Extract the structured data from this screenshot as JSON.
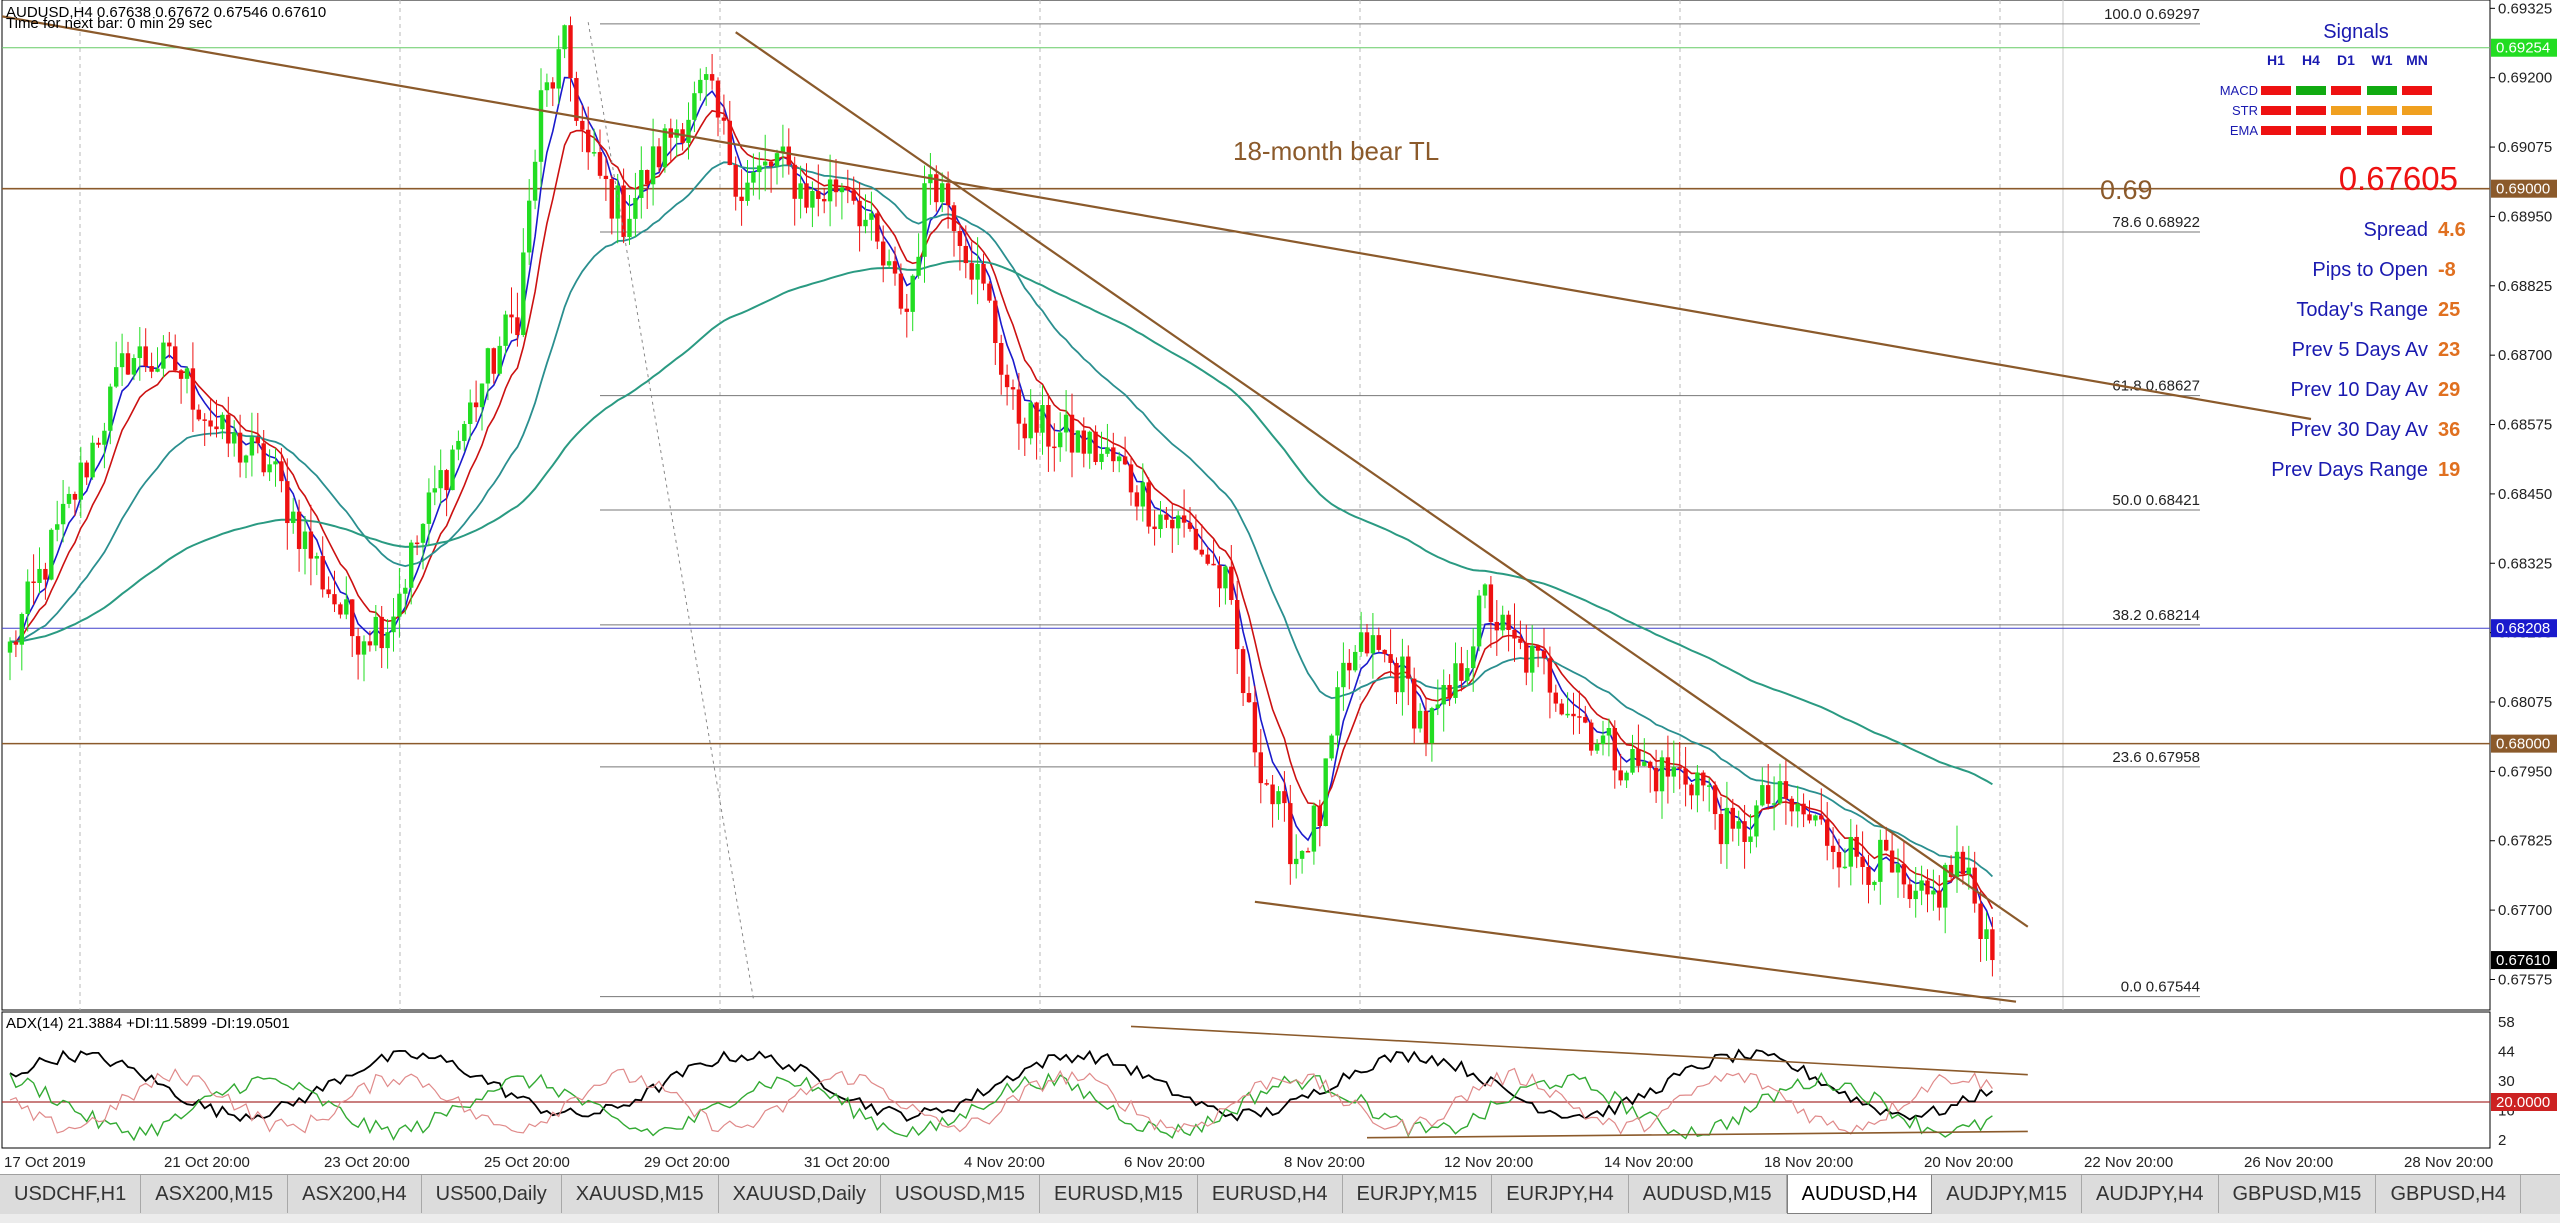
{
  "header": {
    "symbol_line": "AUDUSD,H4  0.67638 0.67672 0.67546 0.67610",
    "timer_line": "Time for next bar: 0 min 29 sec"
  },
  "colors": {
    "bull": "#22dd22",
    "bear": "#ee1111",
    "ema_fast": "#1a1acc",
    "ema_mid": "#cc1111",
    "ema_slow": "#2a8f8f",
    "ema_long": "#2a9a82",
    "trendline": "#8b5a2b",
    "hline_green": "#66cc66",
    "hline_blue": "#4040cc",
    "hline_brown": "#8b5a2b",
    "adx_main": "#000000",
    "adx_plus": "#33aa33",
    "adx_minus": "#e08a8a"
  },
  "annotations": {
    "trendline_label": "18-month bear TL",
    "level_label": "0.69"
  },
  "panel": {
    "signals_title": "Signals",
    "timeframes": [
      "H1",
      "H4",
      "D1",
      "W1",
      "MN"
    ],
    "rows": [
      {
        "name": "MACD",
        "colors": [
          "#ee1111",
          "#11aa11",
          "#ee1111",
          "#11aa11",
          "#ee1111"
        ]
      },
      {
        "name": "STR",
        "colors": [
          "#ee1111",
          "#ee1111",
          "#f0a020",
          "#f0a020",
          "#f0a020"
        ]
      },
      {
        "name": "EMA",
        "colors": [
          "#ee1111",
          "#ee1111",
          "#ee1111",
          "#ee1111",
          "#ee1111"
        ]
      }
    ],
    "price": "0.67605",
    "stats": [
      {
        "label": "Spread",
        "value": "4.6"
      },
      {
        "label": "Pips to Open",
        "value": "-8"
      },
      {
        "label": "Today's Range",
        "value": "25"
      },
      {
        "label": "Prev 5 Days Av",
        "value": "23"
      },
      {
        "label": "Prev 10 Day Av",
        "value": "29"
      },
      {
        "label": "Prev 30 Day Av",
        "value": "36"
      },
      {
        "label": "Prev Days Range",
        "value": "19"
      }
    ]
  },
  "adx": {
    "label": "ADX(14) 21.3884 +DI:11.5899 -DI:19.0501",
    "ticks": [
      "58",
      "44",
      "30",
      "16",
      "2"
    ],
    "level_value": "20.0000",
    "level": 20
  },
  "tabs": [
    "USDCHF,H1",
    "ASX200,M15",
    "ASX200,H4",
    "US500,Daily",
    "XAUUSD,M15",
    "XAUUSD,Daily",
    "USOUSD,M15",
    "EURUSD,M15",
    "EURUSD,H4",
    "EURJPY,M15",
    "EURJPY,H4",
    "AUDUSD,M15",
    "AUDUSD,H4",
    "AUDJPY,M15",
    "AUDJPY,H4",
    "GBPUSD,M15",
    "GBPUSD,H4"
  ],
  "active_tab": "AUDUSD,H4",
  "chart_data": {
    "type": "candlestick",
    "symbol": "AUDUSD",
    "timeframe": "H4",
    "ylim": [
      0.6752,
      0.6934
    ],
    "y_ticks": [
      "0.69325",
      "0.69200",
      "0.69075",
      "0.68950",
      "0.68825",
      "0.68700",
      "0.68575",
      "0.68450",
      "0.68325",
      "0.68200",
      "0.68075",
      "0.67950",
      "0.67825",
      "0.67700",
      "0.67575"
    ],
    "x_ticks": [
      "17 Oct 2019",
      "21 Oct 20:00",
      "23 Oct 20:00",
      "25 Oct 20:00",
      "29 Oct 20:00",
      "31 Oct 20:00",
      "4 Nov 20:00",
      "6 Nov 20:00",
      "8 Nov 20:00",
      "12 Nov 20:00",
      "14 Nov 20:00",
      "18 Nov 20:00",
      "20 Nov 20:00",
      "22 Nov 20:00",
      "26 Nov 20:00",
      "28 Nov 20:00"
    ],
    "price_marks": [
      {
        "value": "0.69254",
        "color": "#22dd22"
      },
      {
        "value": "0.69000",
        "color": "#8b5a2b"
      },
      {
        "value": "0.68208",
        "color": "#1a1acc"
      },
      {
        "value": "0.68000",
        "color": "#8b5a2b"
      },
      {
        "value": "0.67610",
        "color": "#000000"
      }
    ],
    "fib_levels": [
      {
        "label": "100.0",
        "price": "0.69297"
      },
      {
        "label": "78.6",
        "price": "0.68922"
      },
      {
        "label": "61.8",
        "price": "0.68627"
      },
      {
        "label": "50.0",
        "price": "0.68421"
      },
      {
        "label": "38.2",
        "price": "0.68214"
      },
      {
        "label": "23.6",
        "price": "0.67958"
      },
      {
        "label": "0.0",
        "price": "0.67544"
      }
    ],
    "price_anchors": [
      [
        0,
        0.6817
      ],
      [
        12,
        0.6848
      ],
      [
        20,
        0.687
      ],
      [
        28,
        0.6868
      ],
      [
        36,
        0.6855
      ],
      [
        44,
        0.685
      ],
      [
        52,
        0.6832
      ],
      [
        58,
        0.682
      ],
      [
        64,
        0.6822
      ],
      [
        72,
        0.6845
      ],
      [
        80,
        0.6865
      ],
      [
        86,
        0.6878
      ],
      [
        90,
        0.6915
      ],
      [
        94,
        0.6925
      ],
      [
        98,
        0.6905
      ],
      [
        104,
        0.6895
      ],
      [
        112,
        0.691
      ],
      [
        118,
        0.6918
      ],
      [
        124,
        0.69
      ],
      [
        130,
        0.6905
      ],
      [
        136,
        0.6898
      ],
      [
        142,
        0.6902
      ],
      [
        148,
        0.6886
      ],
      [
        152,
        0.6878
      ],
      [
        156,
        0.6904
      ],
      [
        160,
        0.6896
      ],
      [
        166,
        0.6878
      ],
      [
        170,
        0.686
      ],
      [
        176,
        0.6856
      ],
      [
        182,
        0.6854
      ],
      [
        188,
        0.685
      ],
      [
        194,
        0.6842
      ],
      [
        200,
        0.6838
      ],
      [
        206,
        0.6828
      ],
      [
        210,
        0.6804
      ],
      [
        214,
        0.679
      ],
      [
        218,
        0.678
      ],
      [
        222,
        0.6787
      ],
      [
        226,
        0.6812
      ],
      [
        230,
        0.6818
      ],
      [
        236,
        0.6812
      ],
      [
        240,
        0.6802
      ],
      [
        244,
        0.6808
      ],
      [
        250,
        0.6826
      ],
      [
        254,
        0.6818
      ],
      [
        260,
        0.6813
      ],
      [
        266,
        0.6805
      ],
      [
        272,
        0.6798
      ],
      [
        278,
        0.6795
      ],
      [
        286,
        0.6794
      ],
      [
        292,
        0.6782
      ],
      [
        298,
        0.679
      ],
      [
        304,
        0.6787
      ],
      [
        312,
        0.678
      ],
      [
        318,
        0.6778
      ],
      [
        322,
        0.677
      ],
      [
        326,
        0.6772
      ],
      [
        330,
        0.6779
      ],
      [
        334,
        0.6769
      ],
      [
        336,
        0.6761
      ]
    ],
    "trendlines": [
      {
        "name": "18-month bear TL",
        "points": [
          [
            -20,
            0.69345
          ],
          [
            390,
            0.68585
          ]
        ]
      },
      {
        "name": "upper",
        "points": [
          [
            123,
            0.69282
          ],
          [
            342,
            0.6767
          ]
        ]
      },
      {
        "name": "lower",
        "points": [
          [
            211,
            0.67715
          ],
          [
            340,
            0.67535
          ]
        ]
      },
      {
        "name": "dotted",
        "points": [
          [
            98,
            0.693
          ],
          [
            126,
            0.6754
          ]
        ]
      }
    ]
  }
}
